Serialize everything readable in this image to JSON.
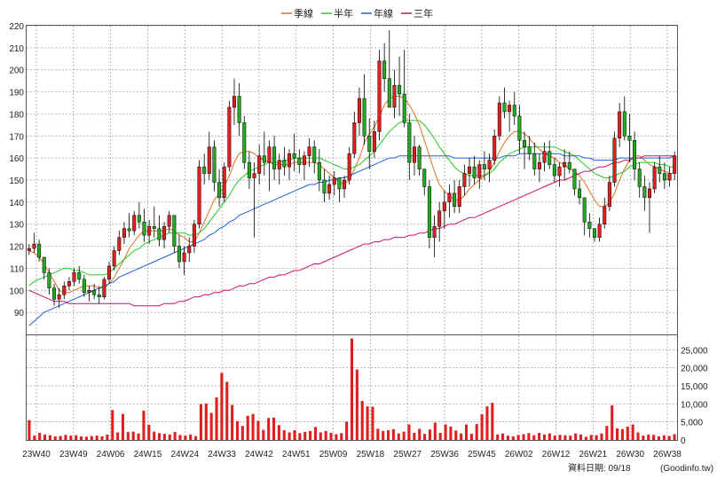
{
  "legend": [
    {
      "label": "季線",
      "color": "#e07020"
    },
    {
      "label": "半年",
      "color": "#22cc22"
    },
    {
      "label": "年線",
      "color": "#2060d0"
    },
    {
      "label": "三年",
      "color": "#cc1166"
    }
  ],
  "footer": {
    "date_label": "資料日期: 09/18",
    "source": "(Goodinfo.tw)"
  },
  "colors": {
    "up": "#e02020",
    "down": "#22aa22",
    "volume": "#e02020",
    "grid": "#999999"
  },
  "chart_data": {
    "type": "candlestick",
    "x_tick_labels": [
      "23W40",
      "23W49",
      "24W06",
      "24W15",
      "24W24",
      "24W33",
      "24W42",
      "24W51",
      "25W09",
      "25W18",
      "25W27",
      "25W36",
      "25W45",
      "26W02",
      "26W12",
      "26W21",
      "26W30",
      "26W38"
    ],
    "price_axis": {
      "ylim": [
        80,
        220
      ],
      "ticks": [
        90,
        100,
        110,
        120,
        130,
        140,
        150,
        160,
        170,
        180,
        190,
        200,
        210,
        220
      ]
    },
    "volume_axis": {
      "ylim": [
        0,
        29000
      ],
      "ticks": [
        0,
        5000,
        10000,
        15000,
        20000,
        25000
      ],
      "tick_labels": [
        "0",
        "5,000",
        "10,000",
        "15,000",
        "20,000",
        "25,000"
      ]
    },
    "grid": true,
    "candles": [
      [
        118,
        121,
        116,
        119
      ],
      [
        119,
        126,
        117,
        121
      ],
      [
        121,
        123,
        113,
        115
      ],
      [
        115,
        112,
        105,
        108
      ],
      [
        108,
        110,
        98,
        101
      ],
      [
        101,
        103,
        93,
        96
      ],
      [
        96,
        101,
        92,
        98
      ],
      [
        98,
        104,
        96,
        102
      ],
      [
        102,
        106,
        100,
        104
      ],
      [
        104,
        110,
        102,
        108
      ],
      [
        108,
        111,
        103,
        105
      ],
      [
        105,
        107,
        97,
        99
      ],
      [
        99,
        102,
        95,
        100
      ],
      [
        100,
        103,
        96,
        98
      ],
      [
        98,
        102,
        94,
        97
      ],
      [
        97,
        106,
        96,
        105
      ],
      [
        105,
        113,
        103,
        111
      ],
      [
        111,
        120,
        109,
        118
      ],
      [
        118,
        127,
        116,
        124
      ],
      [
        124,
        131,
        121,
        128
      ],
      [
        128,
        135,
        124,
        127
      ],
      [
        127,
        136,
        125,
        134
      ],
      [
        134,
        140,
        128,
        131
      ],
      [
        131,
        137,
        122,
        125
      ],
      [
        125,
        132,
        121,
        129
      ],
      [
        129,
        138,
        124,
        128
      ],
      [
        128,
        134,
        120,
        123
      ],
      [
        123,
        131,
        119,
        129
      ],
      [
        129,
        136,
        126,
        134
      ],
      [
        134,
        127,
        117,
        120
      ],
      [
        120,
        125,
        110,
        113
      ],
      [
        113,
        120,
        107,
        117
      ],
      [
        117,
        124,
        113,
        120
      ],
      [
        120,
        132,
        117,
        130
      ],
      [
        130,
        159,
        128,
        156
      ],
      [
        156,
        162,
        148,
        153
      ],
      [
        153,
        172,
        150,
        165
      ],
      [
        165,
        168,
        145,
        149
      ],
      [
        149,
        155,
        138,
        142
      ],
      [
        142,
        158,
        140,
        156
      ],
      [
        156,
        186,
        154,
        183
      ],
      [
        183,
        196,
        175,
        188
      ],
      [
        188,
        194,
        170,
        176
      ],
      [
        176,
        179,
        155,
        158
      ],
      [
        158,
        163,
        146,
        151
      ],
      [
        151,
        158,
        124,
        153
      ],
      [
        153,
        166,
        148,
        161
      ],
      [
        161,
        172,
        152,
        158
      ],
      [
        158,
        168,
        145,
        165
      ],
      [
        165,
        170,
        150,
        155
      ],
      [
        155,
        162,
        148,
        159
      ],
      [
        159,
        165,
        152,
        156
      ],
      [
        156,
        164,
        150,
        162
      ],
      [
        162,
        171,
        154,
        160
      ],
      [
        160,
        164,
        153,
        157
      ],
      [
        157,
        163,
        150,
        161
      ],
      [
        161,
        169,
        156,
        165
      ],
      [
        165,
        168,
        153,
        158
      ],
      [
        158,
        164,
        145,
        150
      ],
      [
        150,
        155,
        140,
        144
      ],
      [
        144,
        152,
        141,
        148
      ],
      [
        148,
        154,
        143,
        151
      ],
      [
        151,
        149,
        140,
        146
      ],
      [
        146,
        152,
        142,
        150
      ],
      [
        150,
        165,
        148,
        162
      ],
      [
        162,
        181,
        160,
        176
      ],
      [
        176,
        192,
        170,
        187
      ],
      [
        187,
        198,
        166,
        170
      ],
      [
        170,
        178,
        155,
        163
      ],
      [
        163,
        177,
        160,
        172
      ],
      [
        172,
        209,
        168,
        204
      ],
      [
        204,
        212,
        190,
        196
      ],
      [
        196,
        218,
        185,
        183
      ],
      [
        183,
        200,
        178,
        193
      ],
      [
        193,
        206,
        179,
        189
      ],
      [
        189,
        209,
        174,
        176
      ],
      [
        176,
        180,
        150,
        158
      ],
      [
        158,
        170,
        152,
        165
      ],
      [
        165,
        166,
        152,
        155
      ],
      [
        155,
        153,
        143,
        147
      ],
      [
        147,
        150,
        119,
        124
      ],
      [
        124,
        134,
        115,
        129
      ],
      [
        129,
        140,
        122,
        136
      ],
      [
        136,
        145,
        128,
        140
      ],
      [
        140,
        148,
        133,
        144
      ],
      [
        144,
        150,
        135,
        138
      ],
      [
        138,
        150,
        135,
        147
      ],
      [
        147,
        157,
        143,
        153
      ],
      [
        153,
        160,
        147,
        156
      ],
      [
        156,
        161,
        148,
        151
      ],
      [
        151,
        159,
        146,
        157
      ],
      [
        157,
        163,
        150,
        155
      ],
      [
        155,
        162,
        149,
        159
      ],
      [
        159,
        173,
        157,
        170
      ],
      [
        170,
        188,
        168,
        185
      ],
      [
        185,
        192,
        178,
        181
      ],
      [
        181,
        186,
        172,
        184
      ],
      [
        184,
        190,
        175,
        179
      ],
      [
        179,
        184,
        162,
        168
      ],
      [
        168,
        172,
        155,
        165
      ],
      [
        165,
        170,
        159,
        162
      ],
      [
        162,
        167,
        152,
        155
      ],
      [
        155,
        162,
        149,
        158
      ],
      [
        158,
        167,
        154,
        163
      ],
      [
        163,
        168,
        155,
        157
      ],
      [
        157,
        160,
        149,
        152
      ],
      [
        152,
        158,
        147,
        156
      ],
      [
        156,
        164,
        150,
        158
      ],
      [
        158,
        163,
        153,
        155
      ],
      [
        155,
        152,
        143,
        146
      ],
      [
        146,
        150,
        139,
        142
      ],
      [
        142,
        137,
        125,
        131
      ],
      [
        131,
        135,
        124,
        128
      ],
      [
        128,
        126,
        122,
        124
      ],
      [
        124,
        133,
        122,
        130
      ],
      [
        130,
        142,
        128,
        138
      ],
      [
        138,
        152,
        136,
        149
      ],
      [
        149,
        172,
        147,
        169
      ],
      [
        169,
        185,
        165,
        181
      ],
      [
        181,
        188,
        168,
        170
      ],
      [
        170,
        180,
        158,
        168
      ],
      [
        168,
        172,
        150,
        155
      ],
      [
        155,
        158,
        142,
        147
      ],
      [
        147,
        152,
        136,
        142
      ],
      [
        142,
        149,
        126,
        146
      ],
      [
        146,
        158,
        144,
        156
      ],
      [
        156,
        161,
        149,
        153
      ],
      [
        153,
        158,
        146,
        150
      ],
      [
        150,
        156,
        147,
        153
      ],
      [
        153,
        163,
        150,
        161
      ]
    ],
    "volume_values": [
      5500,
      1200,
      2000,
      1500,
      1300,
      1000,
      1100,
      1400,
      1200,
      1300,
      1000,
      900,
      1100,
      1200,
      1000,
      1500,
      8300,
      2100,
      7200,
      2200,
      2300,
      1800,
      8100,
      4200,
      2300,
      1900,
      1700,
      1500,
      2200,
      1400,
      1200,
      1500,
      1100,
      9900,
      10100,
      7500,
      11800,
      18600,
      16100,
      9700,
      5200,
      3900,
      6700,
      7200,
      5300,
      2800,
      6100,
      6200,
      4100,
      2700,
      2100,
      2700,
      1900,
      2200,
      2500,
      3600,
      2100,
      2500,
      2000,
      1600,
      1900,
      5100,
      28100,
      19500,
      10800,
      9300,
      9200,
      3100,
      2500,
      2700,
      3000,
      1800,
      2300,
      4300,
      2000,
      3100,
      1700,
      2900,
      4800,
      2000,
      4300,
      3700,
      2600,
      1800,
      4300,
      1700,
      4400,
      7100,
      9300,
      10300,
      1500,
      1800,
      1200,
      1000,
      1400,
      1600,
      1900,
      1300,
      2000,
      1500,
      1800,
      1200,
      1400,
      1300,
      1200,
      1800,
      1500,
      900,
      1400,
      1300,
      1800,
      3900,
      9600,
      3200,
      3000,
      3700,
      4300,
      2100,
      1200,
      1500,
      1400,
      1000,
      1300,
      1100,
      1600
    ],
    "ma_series": [
      {
        "name": "季線",
        "values": [
          118,
          117,
          115,
          112,
          108,
          104,
          100,
          99,
          99,
          100,
          101,
          102,
          102,
          102,
          101,
          101,
          103,
          106,
          110,
          114,
          119,
          122,
          125,
          127,
          127,
          127,
          127,
          127,
          128,
          127,
          125,
          124,
          122,
          122,
          126,
          131,
          136,
          141,
          144,
          147,
          152,
          158,
          162,
          163,
          163,
          162,
          160,
          159,
          158,
          157,
          157,
          157,
          157,
          158,
          158,
          158,
          158,
          158,
          157,
          155,
          153,
          151,
          149,
          148,
          150,
          155,
          160,
          167,
          171,
          174,
          179,
          184,
          187,
          188,
          188,
          187,
          184,
          180,
          175,
          168,
          161,
          154,
          148,
          145,
          143,
          141,
          141,
          143,
          146,
          148,
          150,
          152,
          154,
          158,
          163,
          167,
          170,
          172,
          172,
          171,
          169,
          166,
          164,
          162,
          161,
          160,
          158,
          157,
          155,
          154,
          152,
          149,
          145,
          141,
          138,
          138,
          140,
          144,
          150,
          155,
          159,
          161,
          161,
          159,
          157,
          156,
          155,
          154,
          153,
          153
        ]
      },
      {
        "name": "半年",
        "values": [
          102,
          104,
          105,
          106,
          107,
          108,
          109,
          110,
          110,
          109,
          109,
          108,
          107,
          107,
          107,
          107,
          108,
          110,
          112,
          114,
          116,
          118,
          119,
          121,
          122,
          123,
          124,
          125,
          126,
          126,
          126,
          126,
          125,
          125,
          126,
          128,
          131,
          134,
          137,
          140,
          143,
          147,
          150,
          152,
          154,
          155,
          156,
          157,
          158,
          158,
          158,
          159,
          159,
          160,
          160,
          160,
          160,
          160,
          160,
          159,
          158,
          157,
          156,
          155,
          155,
          156,
          157,
          159,
          161,
          163,
          166,
          169,
          172,
          174,
          176,
          177,
          177,
          177,
          177,
          175,
          172,
          169,
          165,
          162,
          159,
          156,
          154,
          153,
          152,
          152,
          152,
          152,
          153,
          155,
          158,
          160,
          162,
          163,
          164,
          165,
          165,
          165,
          165,
          165,
          165,
          165,
          164,
          163,
          162,
          161,
          159,
          157,
          155,
          153,
          152,
          151,
          151,
          152,
          153,
          154,
          156,
          157,
          158,
          158,
          158,
          158,
          157,
          157,
          156,
          156
        ]
      },
      {
        "name": "年線",
        "values": [
          84,
          86,
          88,
          90,
          91,
          92,
          93,
          94,
          95,
          96,
          97,
          98,
          99,
          100,
          101,
          102,
          103,
          104,
          106,
          107,
          108,
          109,
          110,
          111,
          112,
          113,
          114,
          115,
          116,
          117,
          118,
          119,
          120,
          121,
          122,
          123,
          125,
          126,
          128,
          129,
          131,
          132,
          134,
          135,
          136,
          137,
          138,
          139,
          140,
          141,
          142,
          143,
          144,
          145,
          146,
          147,
          148,
          148,
          149,
          149,
          150,
          150,
          151,
          151,
          152,
          153,
          154,
          155,
          156,
          157,
          158,
          159,
          160,
          160,
          161,
          161,
          161,
          161,
          161,
          161,
          161,
          161,
          161,
          161,
          161,
          160,
          160,
          160,
          160,
          160,
          160,
          160,
          160,
          160,
          160,
          161,
          161,
          161,
          162,
          162,
          162,
          162,
          162,
          162,
          162,
          162,
          162,
          161,
          161,
          161,
          161,
          160,
          160,
          159,
          159,
          159,
          159,
          159,
          160,
          160,
          160,
          160,
          160,
          160,
          160,
          160,
          160,
          160,
          160,
          161
        ]
      },
      {
        "name": "三年",
        "values": [
          100,
          99,
          98,
          97,
          96,
          95,
          95,
          95,
          94,
          94,
          94,
          94,
          94,
          94,
          94,
          94,
          94,
          94,
          94,
          94,
          94,
          93,
          93,
          93,
          93,
          93,
          93,
          94,
          94,
          94,
          95,
          95,
          96,
          97,
          97,
          98,
          98,
          99,
          99,
          100,
          100,
          101,
          102,
          102,
          103,
          103,
          104,
          105,
          106,
          106,
          107,
          107,
          108,
          109,
          109,
          110,
          111,
          112,
          112,
          113,
          114,
          115,
          116,
          117,
          118,
          119,
          120,
          121,
          121,
          122,
          122,
          123,
          123,
          124,
          124,
          124,
          125,
          125,
          126,
          126,
          127,
          128,
          128,
          129,
          130,
          130,
          131,
          132,
          133,
          133,
          134,
          135,
          136,
          137,
          138,
          139,
          140,
          141,
          142,
          143,
          144,
          145,
          146,
          147,
          148,
          149,
          150,
          150,
          151,
          152,
          153,
          154,
          154,
          155,
          156,
          156,
          157,
          158,
          158,
          159,
          159,
          160,
          160,
          161,
          161,
          161,
          161,
          161,
          161,
          161
        ]
      }
    ]
  }
}
